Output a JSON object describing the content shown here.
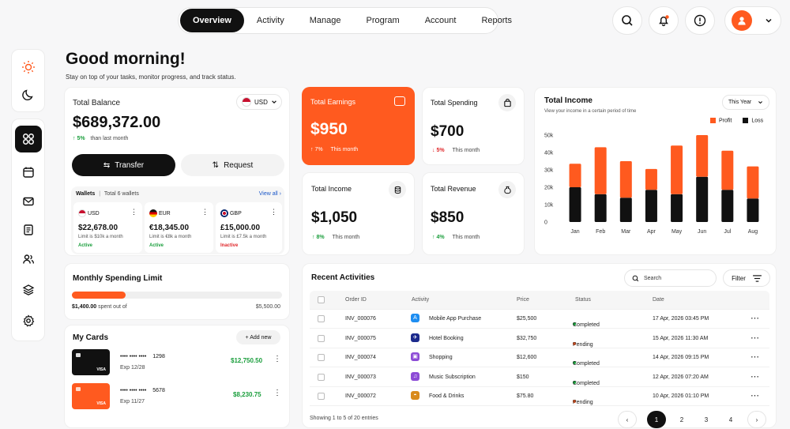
{
  "nav": {
    "items": [
      "Overview",
      "Activity",
      "Manage",
      "Program",
      "Account",
      "Reports"
    ],
    "active_index": 0
  },
  "icons": {
    "header": [
      "search-icon",
      "bell-icon",
      "alert-icon",
      "avatar",
      "chevron-down-icon"
    ],
    "sidebar_theme": [
      "sun-icon",
      "moon-icon"
    ],
    "sidebar_nav": [
      "grid-icon",
      "calendar-icon",
      "mail-icon",
      "document-icon",
      "users-icon",
      "layers-icon",
      "settings-icon"
    ]
  },
  "colors": {
    "accent": "#ff5a1f",
    "dark": "#111111",
    "positive": "#1a9e3c",
    "negative": "#e0282b"
  },
  "greeting": {
    "title": "Good morning!",
    "subtitle": "Stay on top of your tasks, monitor progress, and track status."
  },
  "balance": {
    "label": "Total Balance",
    "currency": "USD",
    "amount": "$689,372.00",
    "change": "5%",
    "change_note": "than last month",
    "transfer_label": "Transfer",
    "request_label": "Request"
  },
  "wallets": {
    "title": "Wallets",
    "count": "Total 6 wallets",
    "view_all": "View all",
    "items": [
      {
        "code": "USD",
        "amount": "$22,678.00",
        "limit": "Limit is $10k a month",
        "status": "Active",
        "status_type": "positive"
      },
      {
        "code": "EUR",
        "amount": "€18,345.00",
        "limit": "Limit is €8k a month",
        "status": "Active",
        "status_type": "positive"
      },
      {
        "code": "GBP",
        "amount": "£15,000.00",
        "limit": "Limit is £7.5k a month",
        "status": "Inactive",
        "status_type": "negative"
      }
    ]
  },
  "stats": {
    "earnings": {
      "label": "Total Earnings",
      "value": "$950",
      "change": "7%",
      "note": "This month",
      "direction": "up"
    },
    "spending": {
      "label": "Total Spending",
      "value": "$700",
      "change": "5%",
      "note": "This month",
      "direction": "down"
    },
    "income": {
      "label": "Total Income",
      "value": "$1,050",
      "change": "8%",
      "note": "This month",
      "direction": "up"
    },
    "revenue": {
      "label": "Total Revenue",
      "value": "$850",
      "change": "4%",
      "note": "This month",
      "direction": "up"
    }
  },
  "income_chart": {
    "title": "Total Income",
    "subtitle": "View your income in a certain period of time",
    "period": "This Year",
    "legend": [
      "Profit",
      "Loss"
    ]
  },
  "chart_data": {
    "type": "bar",
    "stacked": true,
    "categories": [
      "Jan",
      "Feb",
      "Mar",
      "Apr",
      "May",
      "Jun",
      "Jul",
      "Aug"
    ],
    "series": [
      {
        "name": "Loss",
        "color": "#111111",
        "values": [
          20000,
          16000,
          14000,
          18500,
          16000,
          26000,
          18500,
          13500
        ]
      },
      {
        "name": "Profit",
        "color": "#ff5a1f",
        "values": [
          13500,
          27000,
          21000,
          12000,
          28000,
          24000,
          22500,
          18500
        ]
      }
    ],
    "ylim": [
      0,
      50000
    ],
    "yticks": [
      "0",
      "10k",
      "20k",
      "30k",
      "40k",
      "50k"
    ],
    "legend_position": "top-right",
    "grid": false
  },
  "spending_limit": {
    "title": "Monthly Spending Limit",
    "spent": "$1,400.00",
    "spent_note": "spent out of",
    "total": "$5,500.00",
    "fraction": 0.255
  },
  "cards": {
    "title": "My Cards",
    "add_label": "+ Add new",
    "items": [
      {
        "number": "•••• •••• ••••",
        "last4": "1298",
        "exp": "Exp 12/28",
        "amount": "$12,750.50",
        "brand": "VISA",
        "color": "#111111"
      },
      {
        "number": "•••• •••• ••••",
        "last4": "5678",
        "exp": "Exp 11/27",
        "amount": "$8,230.75",
        "brand": "VISA",
        "color": "#ff5a1f"
      }
    ]
  },
  "activities": {
    "title": "Recent Activities",
    "search_placeholder": "Search",
    "filter_label": "Filter",
    "columns": [
      "Order ID",
      "Activity",
      "Price",
      "Status",
      "Date"
    ],
    "rows": [
      {
        "id": "INV_000076",
        "activity": "Mobile App Purchase",
        "icon": "app-store-icon",
        "price": "$25,500",
        "status": "Completed",
        "date": "17 Apr, 2026 03:45 PM"
      },
      {
        "id": "INV_000075",
        "activity": "Hotel Booking",
        "icon": "airplane-icon",
        "price": "$32,750",
        "status": "Pending",
        "date": "15 Apr, 2026 11:30 AM"
      },
      {
        "id": "INV_000074",
        "activity": "Shopping",
        "icon": "shopping-bag-icon",
        "price": "$12,600",
        "status": "Completed",
        "date": "14 Apr, 2026 09:15 PM"
      },
      {
        "id": "INV_000073",
        "activity": "Music Subscription",
        "icon": "music-icon",
        "price": "$150",
        "status": "Completed",
        "date": "12 Apr, 2026 07:20 AM"
      },
      {
        "id": "INV_000072",
        "activity": "Food & Drinks",
        "icon": "burger-icon",
        "price": "$75.80",
        "status": "Pending",
        "date": "10 Apr, 2026 01:10 PM"
      }
    ],
    "footer": "Showing 1 to 5 of 20 entries",
    "pages": [
      "1",
      "2",
      "3",
      "4"
    ],
    "current_page": "1"
  }
}
